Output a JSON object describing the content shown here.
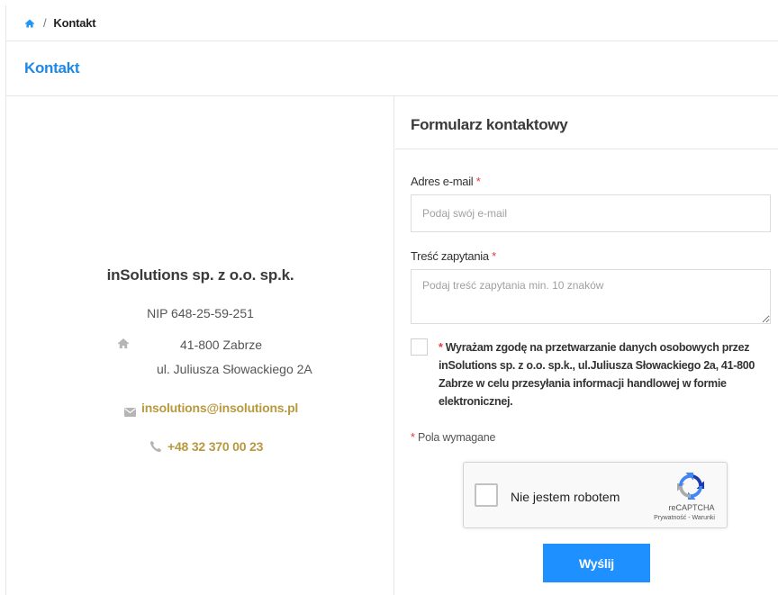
{
  "breadcrumb": {
    "current": "Kontakt"
  },
  "page": {
    "title": "Kontakt"
  },
  "company": {
    "name": "inSolutions sp. z o.o. sp.k.",
    "nip": "NIP 648-25-59-251",
    "address_line1": "41-800 Zabrze",
    "address_line2": "ul. Juliusza Słowackiego 2A",
    "email": "insolutions@insolutions.pl",
    "phone": "+48 32 370 00 23"
  },
  "form": {
    "title": "Formularz kontaktowy",
    "email_label": "Adres e-mail",
    "email_placeholder": "Podaj swój e-mail",
    "message_label": "Treść zapytania",
    "message_placeholder": "Podaj treść zapytania min. 10 znaków",
    "required_marker": "*",
    "consent_text": "Wyrażam zgodę na przetwarzanie danych osobowych przez inSolutions sp. z o.o. sp.k., ul.Juliusza Słowackiego 2a, 41-800 Zabrze w celu przesyłania informacji handlowej w formie elektronicznej.",
    "required_note": "Pola wymagane",
    "submit_label": "Wyślij"
  },
  "recaptcha": {
    "label": "Nie jestem robotem",
    "brand": "reCAPTCHA",
    "links": "Prywatność - Warunki"
  },
  "colors": {
    "accent": "#1e88e5",
    "link_gold": "#b8993f",
    "required": "#e53935",
    "button": "#1e90ff"
  }
}
